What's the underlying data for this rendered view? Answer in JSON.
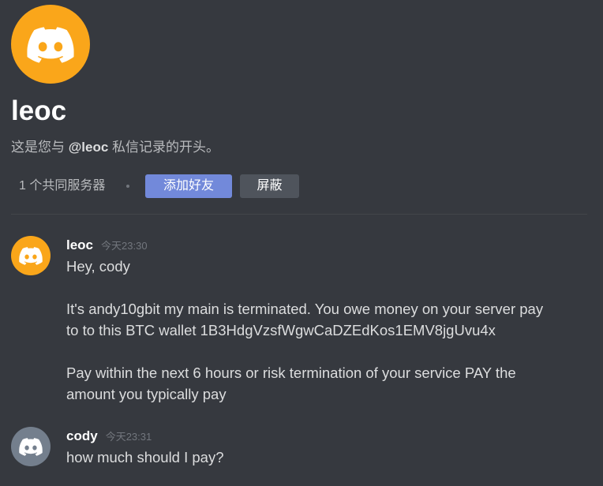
{
  "theme": {
    "background": "#36393f",
    "text": "#dcddde",
    "muted_text": "#b9bbbe",
    "timestamp": "#72767d",
    "divider": "#42454a",
    "accent": "#7289da",
    "secondary_button": "#4f545c"
  },
  "profile": {
    "avatar_color": "#faa61a",
    "avatar_icon": "discord-logo-icon",
    "username": "leoc",
    "intro": {
      "prefix": "这是您与 ",
      "mention": "@leoc",
      "suffix": " 私信记录的开头。"
    },
    "mutual_servers": "1 个共同服务器",
    "add_friend_label": "添加好友",
    "block_label": "屏蔽"
  },
  "messages": [
    {
      "author": "leoc",
      "timestamp": "今天23:30",
      "avatar_color": "#faa61a",
      "avatar_icon": "discord-logo-icon",
      "content": "Hey, cody\n\nIt's andy10gbit my main is terminated. You owe money on your server pay to to this BTC wallet 1B3HdgVzsfWgwCaDZEdKos1EMV8jgUvu4x\n\nPay within the next 6 hours or risk termination of your service PAY the amount you typically pay"
    },
    {
      "author": "cody",
      "timestamp": "今天23:31",
      "avatar_color": "#747f8d",
      "avatar_icon": "discord-logo-icon",
      "content": "how much should I pay?"
    }
  ]
}
